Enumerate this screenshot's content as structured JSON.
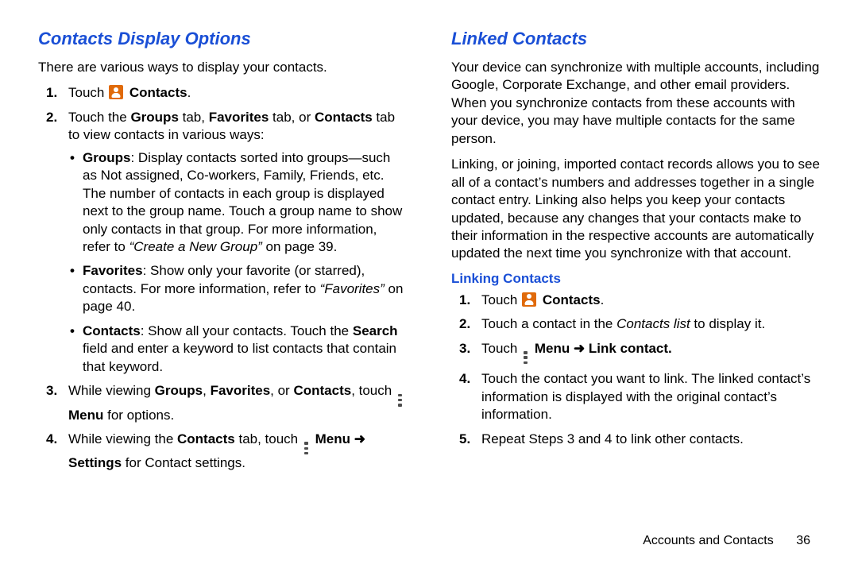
{
  "left": {
    "title": "Contacts Display Options",
    "intro": "There are various ways to display your contacts.",
    "step1_pre": "Touch ",
    "step1_label": "Contacts",
    "step1_post": ".",
    "step2a": "Touch the ",
    "step2_groups": "Groups",
    "step2b": " tab, ",
    "step2_fav": "Favorites",
    "step2c": " tab, or ",
    "step2_contacts": "Contacts",
    "step2d": " tab to view contacts in various ways:",
    "groups_h": "Groups",
    "groups_t": ": Display contacts sorted into groups—such as Not assigned, Co-workers, Family, Friends, etc. The number of contacts in each group is displayed next to the group name. Touch a group name to show only contacts in that group. For more information, refer to ",
    "groups_ref": "“Create a New Group”",
    "groups_page": " on page 39.",
    "fav_h": "Favorites",
    "fav_t": ": Show only your favorite (or starred), contacts. For more information, refer to ",
    "fav_ref": "“Favorites”",
    "fav_page": " on page 40.",
    "con_h": "Contacts",
    "con_t1": ": Show all your contacts. Touch the ",
    "con_search": "Search",
    "con_t2": " field and enter a keyword to list contacts that contain that keyword.",
    "step3a": "While viewing ",
    "step3_g": "Groups",
    "step3b": ", ",
    "step3_f": "Favorites",
    "step3c": ", or ",
    "step3_c": "Contacts",
    "step3d": ", touch ",
    "step3_menu": "Menu",
    "step3e": " for options.",
    "step4a": "While viewing the ",
    "step4_c": "Contacts",
    "step4b": " tab, touch ",
    "step4_menu": "Menu",
    "step4_settings": "Settings",
    "step4c": " for Contact settings."
  },
  "right": {
    "title": "Linked Contacts",
    "p1": "Your device can synchronize with multiple accounts, including Google, Corporate Exchange, and other email providers. When you synchronize contacts from these accounts with your device, you may have multiple contacts for the same person.",
    "p2": "Linking, or joining, imported contact records allows you to see all of a contact’s numbers and addresses together in a single contact entry. Linking also helps you keep your contacts updated, because any changes that your contacts make to their information in the respective accounts are automatically updated the next time you synchronize with that account.",
    "sub": "Linking Contacts",
    "s1_pre": "Touch ",
    "s1_label": "Contacts",
    "s1_post": ".",
    "s2a": "Touch a contact in the ",
    "s2list": "Contacts list",
    "s2b": " to display it.",
    "s3a": "Touch ",
    "s3_menu": "Menu",
    "s3_link": "Link contact.",
    "s4": "Touch the contact you want to link. The linked contact’s information is displayed with the original contact’s information.",
    "s5": "Repeat Steps 3 and 4 to link other contacts."
  },
  "footer": {
    "section": "Accounts and Contacts",
    "page": "36"
  },
  "arrow": " ➜ "
}
